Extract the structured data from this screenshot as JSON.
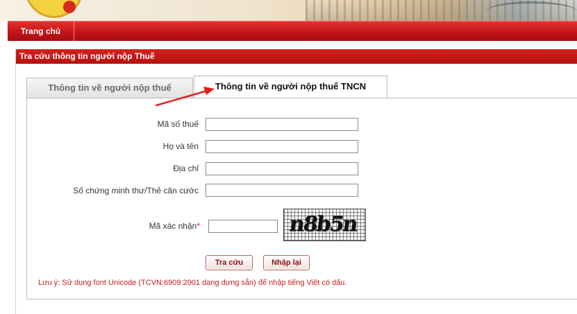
{
  "nav": {
    "items": [
      {
        "label": "Trang chủ"
      }
    ]
  },
  "panel": {
    "title": "Tra cứu thông tin người nộp Thuế"
  },
  "tabs": [
    {
      "label": "Thông tin về người nộp thuế",
      "active": false
    },
    {
      "label": "Thông tin về người nộp thuế TNCN",
      "active": true
    }
  ],
  "form": {
    "fields": [
      {
        "label": "Mã số thuế",
        "value": ""
      },
      {
        "label": "Họ và tên",
        "value": ""
      },
      {
        "label": "Địa chỉ",
        "value": ""
      },
      {
        "label": "Số chứng minh thư/Thẻ căn cước",
        "value": ""
      }
    ],
    "captcha": {
      "label": "Mã xác nhận",
      "required_mark": "*",
      "value": "",
      "image_text": "n8b5n"
    },
    "buttons": {
      "search": "Tra cứu",
      "reset": "Nhập lại"
    },
    "note": "Lưu ý: Sử dụng font Unicode (TCVN:6909:2001 dạng dựng sẵn) để nhập tiếng Việt có dấu."
  },
  "colors": {
    "brand_red": "#c4141a",
    "annotation_arrow": "#e0201c",
    "note_text": "#c41e1e"
  }
}
